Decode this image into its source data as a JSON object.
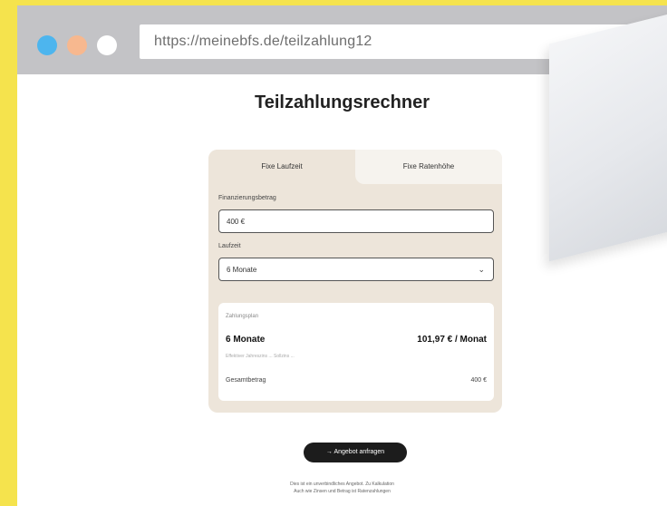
{
  "browser": {
    "url": "https://meinebfs.de/teilzahlung12"
  },
  "page": {
    "title": "Teilzahlungsrechner"
  },
  "calculator": {
    "tabs": [
      {
        "label": "Fixe Laufzeit"
      },
      {
        "label": "Fixe Ratenhöhe"
      }
    ],
    "amount_label": "Finanzierungsbetrag",
    "amount_value": "400 €",
    "term_label": "Laufzeit",
    "term_value": "6 Monate",
    "result": {
      "subtitle": "Zahlungsplan",
      "months": "6 Monate",
      "rate": "101,97 € / Monat",
      "note": "Effektiver Jahreszins ... Sollzins ...",
      "total_label": "Gesamtbetrag",
      "total_value": "400 €"
    }
  },
  "cta": {
    "label": "→ Angebot anfragen"
  },
  "footer": {
    "line1": "Dies ist ein unverbindliches Angebot. Zu Kalkulation",
    "line2": "Auch wie Zinsen und Betrag ist Ratenzahlungen"
  },
  "icons": {
    "chevron": "chevron-down-icon"
  }
}
